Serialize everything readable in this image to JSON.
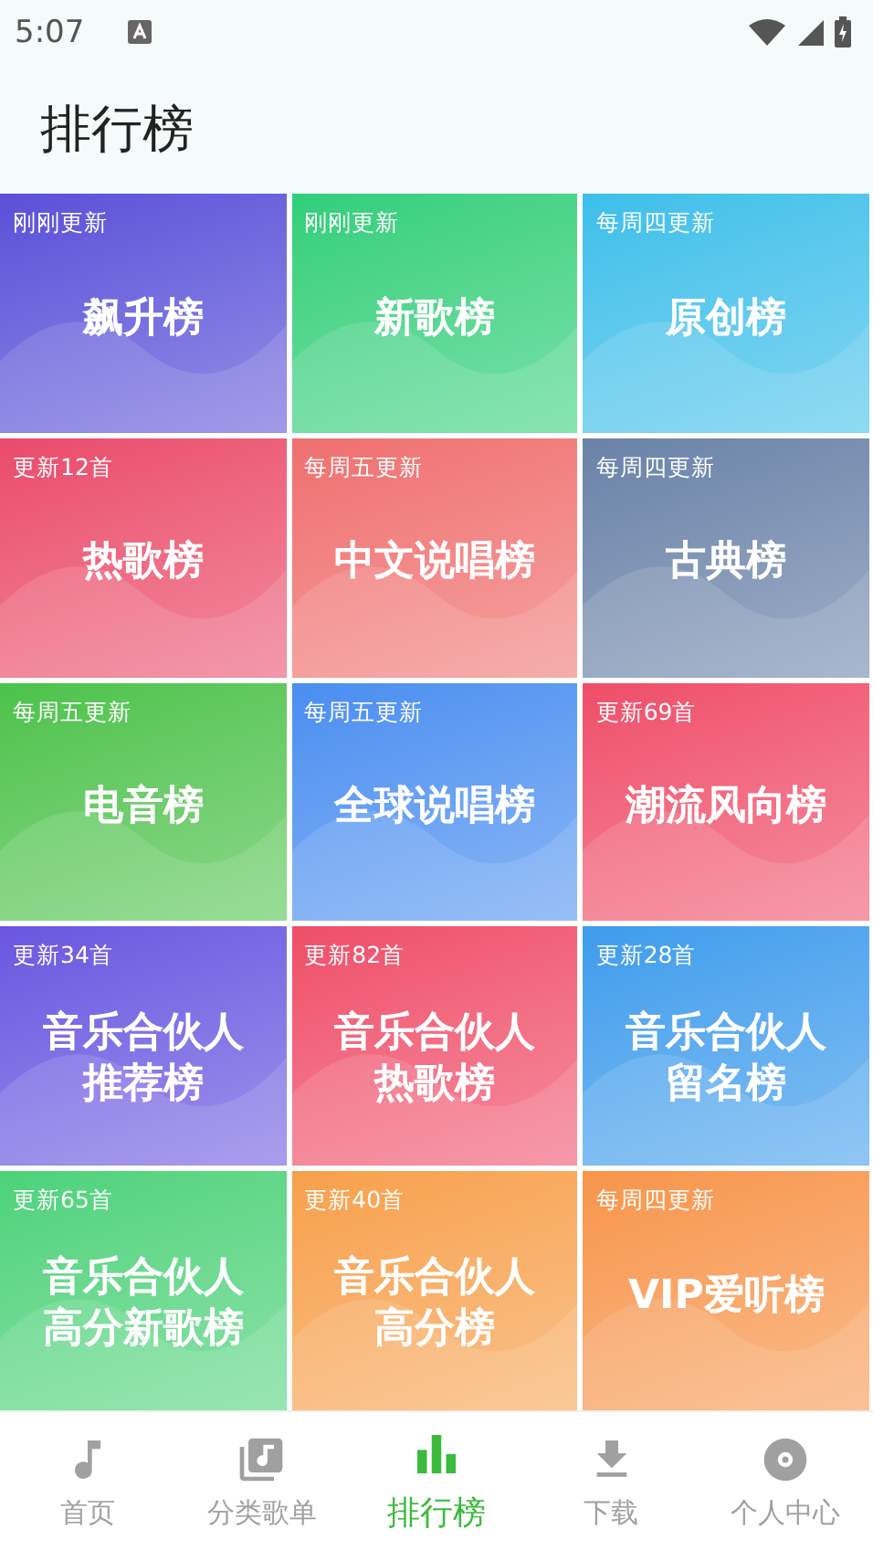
{
  "status_bar": {
    "time": "5:07"
  },
  "header": {
    "title": "排行榜"
  },
  "charts": [
    {
      "update": "刚刚更新",
      "title_lines": [
        "飙升榜"
      ],
      "color": "#5b4fd8"
    },
    {
      "update": "刚刚更新",
      "title_lines": [
        "新歌榜"
      ],
      "color": "#2ecf7a"
    },
    {
      "update": "每周四更新",
      "title_lines": [
        "原创榜"
      ],
      "color": "#3bbfea"
    },
    {
      "update": "更新12首",
      "title_lines": [
        "热歌榜"
      ],
      "color": "#ea4a6a"
    },
    {
      "update": "每周五更新",
      "title_lines": [
        "中文说唱榜"
      ],
      "color": "#ef6f6f"
    },
    {
      "update": "每周四更新",
      "title_lines": [
        "古典榜"
      ],
      "color": "#6a82a8"
    },
    {
      "update": "每周五更新",
      "title_lines": [
        "电音榜"
      ],
      "color": "#4cc24a"
    },
    {
      "update": "每周五更新",
      "title_lines": [
        "全球说唱榜"
      ],
      "color": "#4a8ef0"
    },
    {
      "update": "更新69首",
      "title_lines": [
        "潮流风向榜"
      ],
      "color": "#ef4d6a"
    },
    {
      "update": "更新34首",
      "title_lines": [
        "音乐合伙人",
        "推荐榜"
      ],
      "color": "#6b55e0"
    },
    {
      "update": "更新82首",
      "title_lines": [
        "音乐合伙人",
        "热歌榜"
      ],
      "color": "#ef4d6a"
    },
    {
      "update": "更新28首",
      "title_lines": [
        "音乐合伙人",
        "留名榜"
      ],
      "color": "#3d9cec"
    },
    {
      "update": "更新65首",
      "title_lines": [
        "音乐合伙人",
        "高分新歌榜"
      ],
      "color": "#4cd27a"
    },
    {
      "update": "更新40首",
      "title_lines": [
        "音乐合伙人",
        "高分榜"
      ],
      "color": "#f7a04a"
    },
    {
      "update": "每周四更新",
      "title_lines": [
        "VIP爱听榜"
      ],
      "color": "#f7954a"
    }
  ],
  "bottom_nav": [
    {
      "kind": "note",
      "label": "首页",
      "selected": false
    },
    {
      "kind": "playlist",
      "label": "分类歌单",
      "selected": false
    },
    {
      "kind": "chart",
      "label": "排行榜",
      "selected": true
    },
    {
      "kind": "download",
      "label": "下载",
      "selected": false
    },
    {
      "kind": "disc",
      "label": "个人中心",
      "selected": false
    }
  ]
}
